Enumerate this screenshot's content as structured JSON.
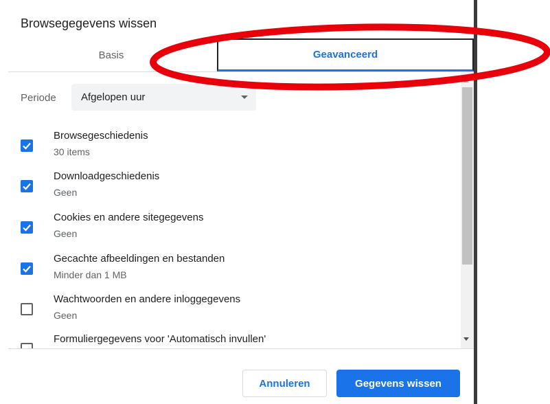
{
  "dialog": {
    "title": "Browsegegevens wissen",
    "tabs": [
      {
        "label": "Basis",
        "selected": false
      },
      {
        "label": "Geavanceerd",
        "selected": true
      }
    ],
    "period": {
      "label": "Periode",
      "value": "Afgelopen uur"
    },
    "options": [
      {
        "title": "Browsegeschiedenis",
        "subtitle": "30 items",
        "checked": true
      },
      {
        "title": "Downloadgeschiedenis",
        "subtitle": "Geen",
        "checked": true
      },
      {
        "title": "Cookies en andere sitegegevens",
        "subtitle": "Geen",
        "checked": true
      },
      {
        "title": "Gecachte afbeeldingen en bestanden",
        "subtitle": "Minder dan 1 MB",
        "checked": true
      },
      {
        "title": "Wachtwoorden en andere inloggegevens",
        "subtitle": "Geen",
        "checked": false
      },
      {
        "title": "Formuliergegevens voor 'Automatisch invullen'",
        "subtitle": "",
        "checked": false
      }
    ],
    "buttons": {
      "cancel": "Annuleren",
      "clear": "Gegevens wissen"
    }
  },
  "colors": {
    "accent": "#1a73e8",
    "highlight_ellipse": "#e8000b",
    "text": "#202124",
    "secondary_text": "#5f6368"
  },
  "icons": {
    "checkbox_checked": "check-icon",
    "dropdown": "chevron-down-icon"
  }
}
